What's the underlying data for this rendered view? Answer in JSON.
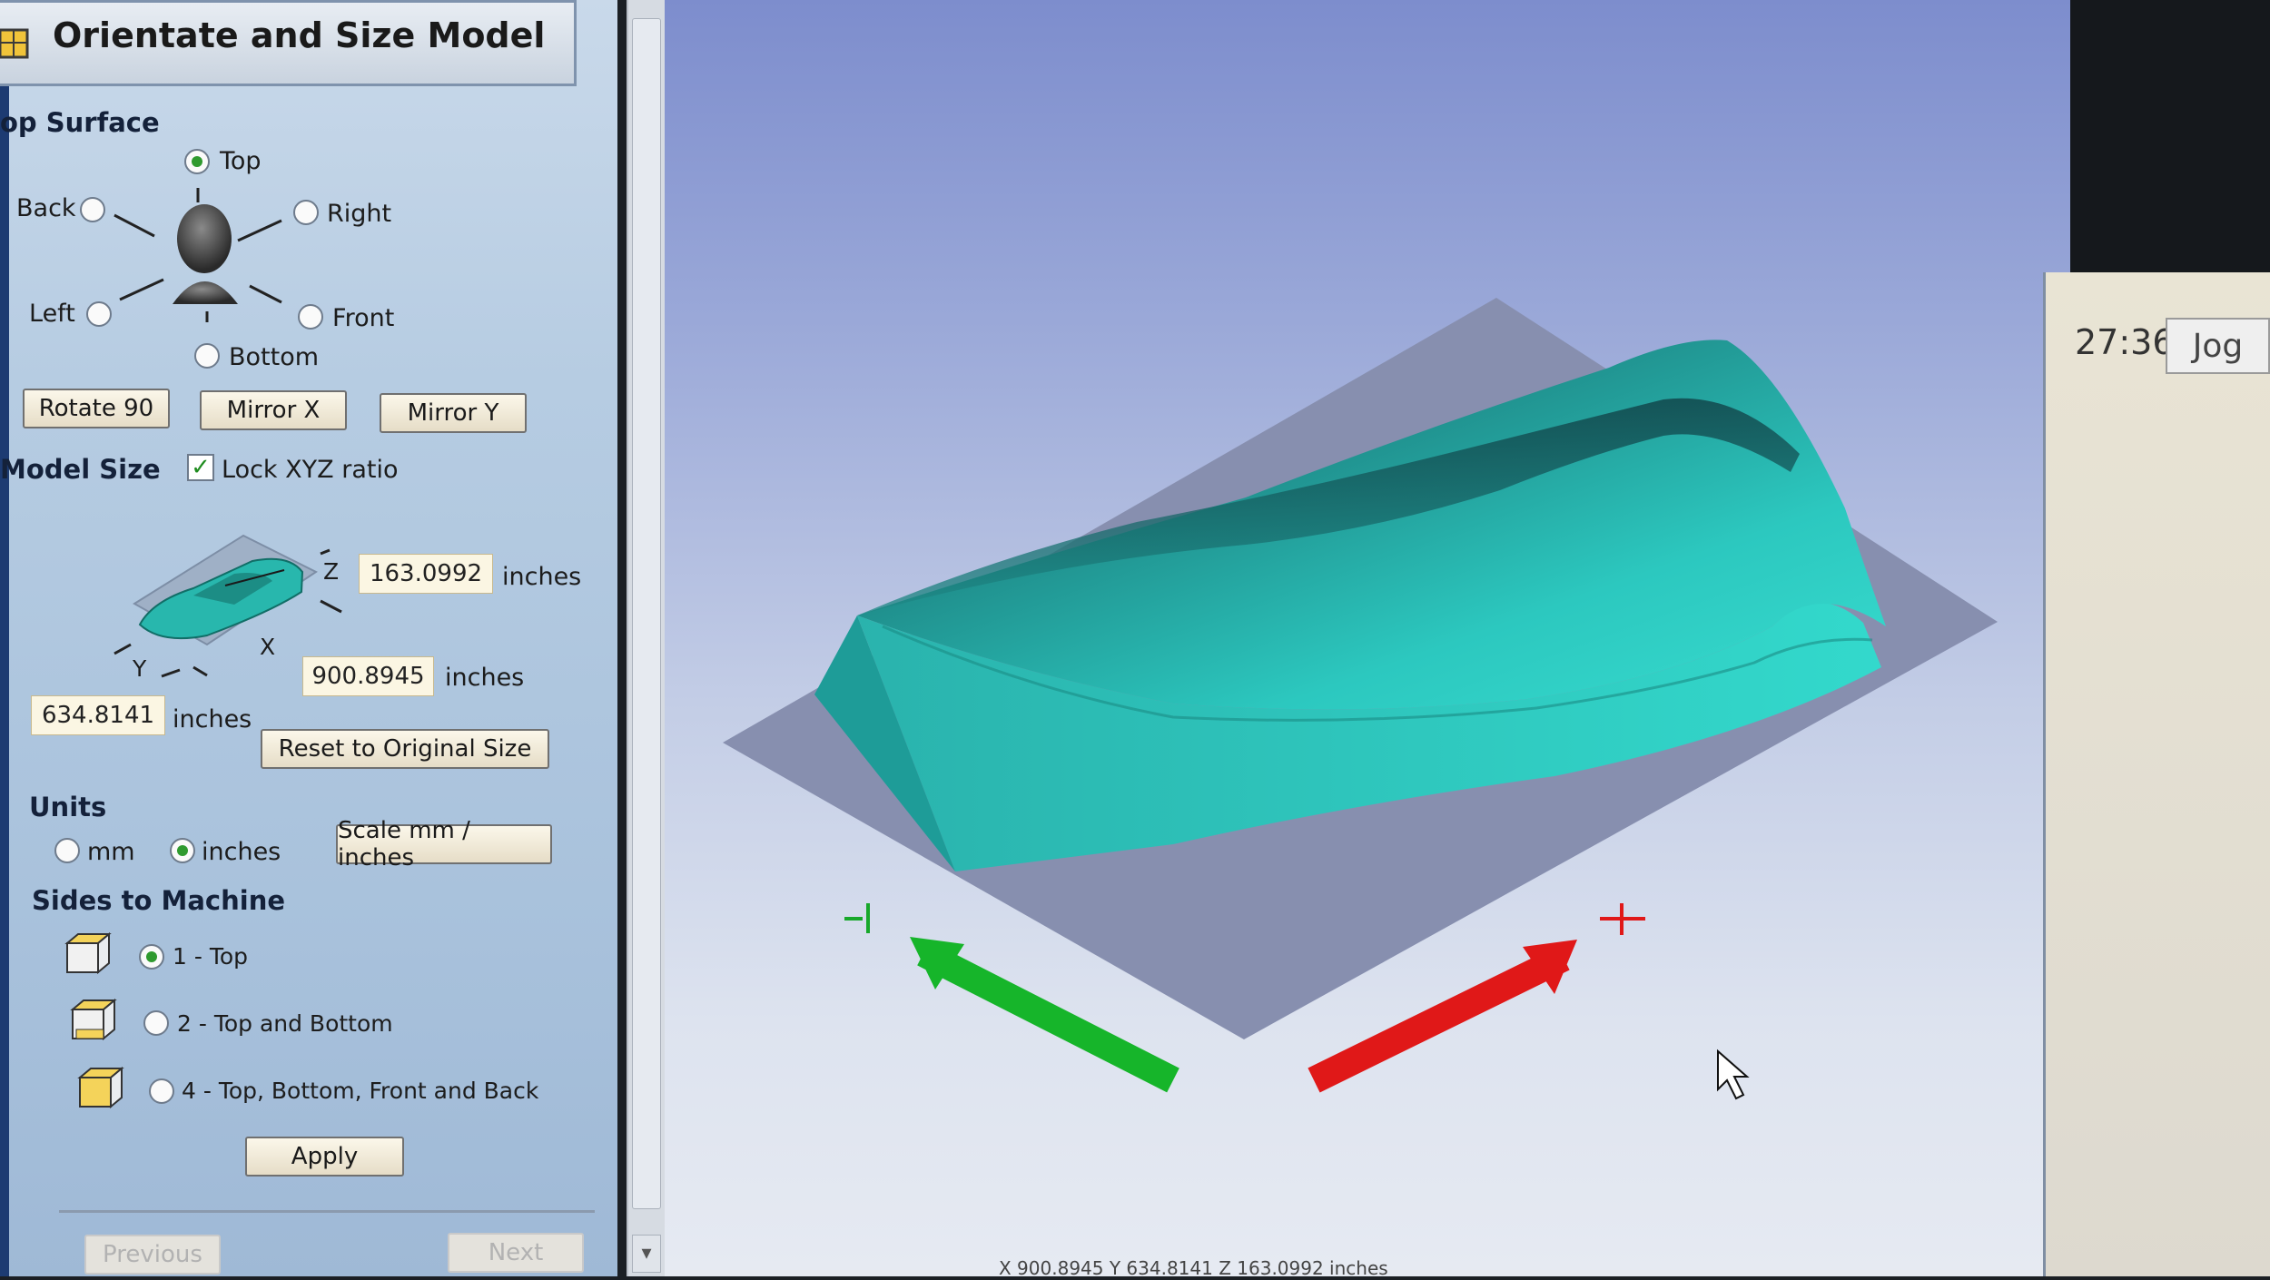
{
  "panel": {
    "title": "Orientate and Size Model",
    "top_surface": {
      "heading": "op Surface",
      "options": [
        "Top",
        "Back",
        "Right",
        "Left",
        "Front",
        "Bottom"
      ],
      "selected": "Top",
      "buttons": [
        "Rotate 90",
        "Mirror X",
        "Mirror Y"
      ]
    },
    "model_size": {
      "heading": "Model Size",
      "lock_label": "Lock XYZ ratio",
      "lock_checked": true,
      "z_value": "163.0992",
      "x_value": "900.8945",
      "y_value": "634.8141",
      "unit": "inches",
      "axis_z": "Z",
      "axis_x": "X",
      "axis_y": "Y",
      "reset_label": "Reset to Original Size"
    },
    "units": {
      "heading": "Units",
      "mm_label": "mm",
      "inches_label": "inches",
      "selected": "inches",
      "scale_label": "Scale mm / inches"
    },
    "sides": {
      "heading": "Sides to Machine",
      "options": [
        "1 - Top",
        "2 - Top and Bottom",
        "4 - Top, Bottom, Front and Back"
      ],
      "selected": "1 - Top",
      "apply_label": "Apply"
    },
    "nav": {
      "previous": "Previous",
      "next": "Next"
    }
  },
  "viewport": {
    "status_text": "X 900.8945 Y 634.8141 Z 163.0992 inches",
    "model_color": "#2fd3c6",
    "plane_color": "#8890b0",
    "x_arrow_color": "#e01818",
    "y_arrow_color": "#16b52a"
  },
  "right_window": {
    "timer": "27:36",
    "jog": "Jog"
  }
}
